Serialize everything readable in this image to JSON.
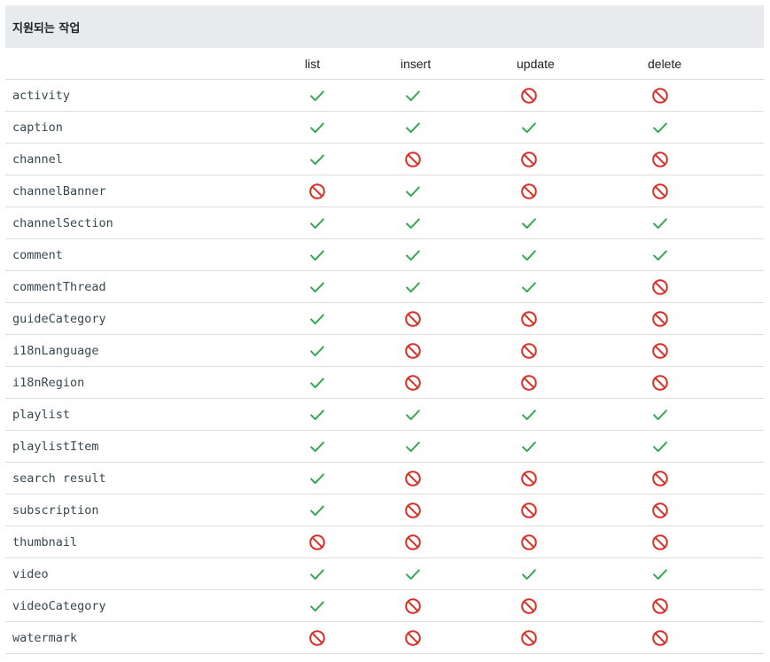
{
  "caption": "지원되는 작업",
  "columns": [
    "list",
    "insert",
    "update",
    "delete"
  ],
  "colors": {
    "supported": "#34a853",
    "unsupported": "#d93025"
  },
  "icons": {
    "supported": "check-icon",
    "unsupported": "not-supported-icon"
  },
  "rows": [
    {
      "resource": "activity",
      "ops": [
        true,
        true,
        false,
        false
      ]
    },
    {
      "resource": "caption",
      "ops": [
        true,
        true,
        true,
        true
      ]
    },
    {
      "resource": "channel",
      "ops": [
        true,
        false,
        false,
        false
      ]
    },
    {
      "resource": "channelBanner",
      "ops": [
        false,
        true,
        false,
        false
      ]
    },
    {
      "resource": "channelSection",
      "ops": [
        true,
        true,
        true,
        true
      ]
    },
    {
      "resource": "comment",
      "ops": [
        true,
        true,
        true,
        true
      ]
    },
    {
      "resource": "commentThread",
      "ops": [
        true,
        true,
        true,
        false
      ]
    },
    {
      "resource": "guideCategory",
      "ops": [
        true,
        false,
        false,
        false
      ]
    },
    {
      "resource": "i18nLanguage",
      "ops": [
        true,
        false,
        false,
        false
      ]
    },
    {
      "resource": "i18nRegion",
      "ops": [
        true,
        false,
        false,
        false
      ]
    },
    {
      "resource": "playlist",
      "ops": [
        true,
        true,
        true,
        true
      ]
    },
    {
      "resource": "playlistItem",
      "ops": [
        true,
        true,
        true,
        true
      ]
    },
    {
      "resource": "search result",
      "ops": [
        true,
        false,
        false,
        false
      ]
    },
    {
      "resource": "subscription",
      "ops": [
        true,
        false,
        false,
        false
      ]
    },
    {
      "resource": "thumbnail",
      "ops": [
        false,
        false,
        false,
        false
      ]
    },
    {
      "resource": "video",
      "ops": [
        true,
        true,
        true,
        true
      ]
    },
    {
      "resource": "videoCategory",
      "ops": [
        true,
        false,
        false,
        false
      ]
    },
    {
      "resource": "watermark",
      "ops": [
        false,
        false,
        false,
        false
      ]
    }
  ]
}
